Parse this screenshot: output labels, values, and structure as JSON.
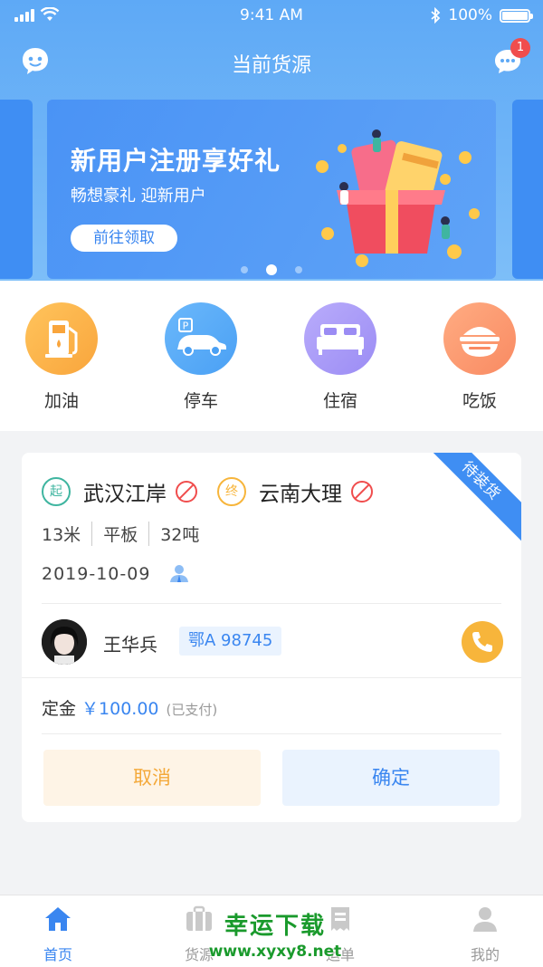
{
  "status_bar": {
    "time": "9:41 AM",
    "battery": "100%"
  },
  "nav": {
    "title": "当前货源",
    "message_badge": "1",
    "left_icon": "chat-smile-icon",
    "right_icon": "message-bubble-icon"
  },
  "banner": {
    "title": "新用户注册享好礼",
    "subtitle": "畅想豪礼 迎新用户",
    "button": "前往领取"
  },
  "services": [
    {
      "label": "加油",
      "icon": "fuel-pump-icon",
      "color": "#f9a53c"
    },
    {
      "label": "停车",
      "icon": "parking-car-icon",
      "color": "#4aa0f4"
    },
    {
      "label": "住宿",
      "icon": "bed-icon",
      "color": "#9b8cf4"
    },
    {
      "label": "吃饭",
      "icon": "rice-bowl-icon",
      "color": "#f98a62"
    }
  ],
  "order": {
    "status_ribbon": "待装货",
    "origin_mark": "起",
    "origin": "武汉江岸",
    "dest_mark": "终",
    "destination": "云南大理",
    "specs": [
      "13米",
      "平板",
      "32吨"
    ],
    "date": "2019-10-09",
    "driver_name": "王华兵",
    "plate": "鄂A 98745",
    "deposit_label": "定金",
    "deposit_amount": "￥100.00",
    "deposit_status": "(已支付)",
    "cancel": "取消",
    "confirm": "确定"
  },
  "tabs": [
    {
      "label": "首页",
      "icon": "home-icon",
      "active": true
    },
    {
      "label": "货源",
      "icon": "cargo-icon",
      "active": false
    },
    {
      "label": "运单",
      "icon": "waybill-icon",
      "active": false
    },
    {
      "label": "我的",
      "icon": "user-icon",
      "active": false
    }
  ],
  "watermark": {
    "line1": "幸运下载",
    "line2": "www.xyxy8.net"
  }
}
